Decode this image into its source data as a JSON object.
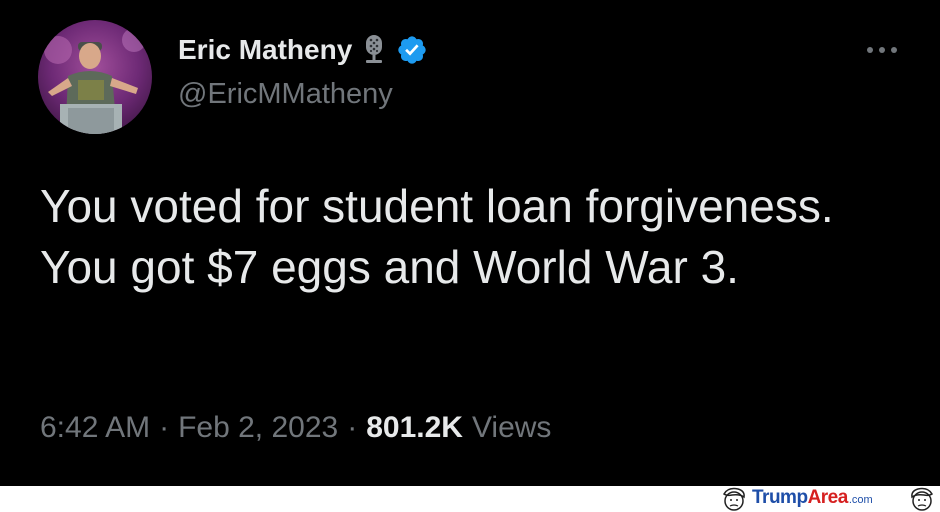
{
  "author": {
    "display_name": "Eric Matheny",
    "handle": "@EricMMatheny",
    "badge_icon": "microphone-icon",
    "verified_icon": "verified-badge-icon",
    "verified_color": "#1d9bf0"
  },
  "tweet": {
    "text": "You voted for student loan forgiveness. You got $7 eggs and World War 3."
  },
  "meta": {
    "time": "6:42 AM",
    "separator": "·",
    "date": "Feb 2, 2023",
    "views_count": "801.2K",
    "views_label": "Views"
  },
  "menu": {
    "icon": "more-options-icon"
  },
  "watermark": {
    "part1": "Trump",
    "part2": "Area",
    "suffix": ".com",
    "color_primary": "#1e4ea8",
    "color_accent": "#d62020"
  },
  "colors": {
    "background": "#000000",
    "text_primary": "#e7e9ea",
    "text_secondary": "#71767b"
  }
}
